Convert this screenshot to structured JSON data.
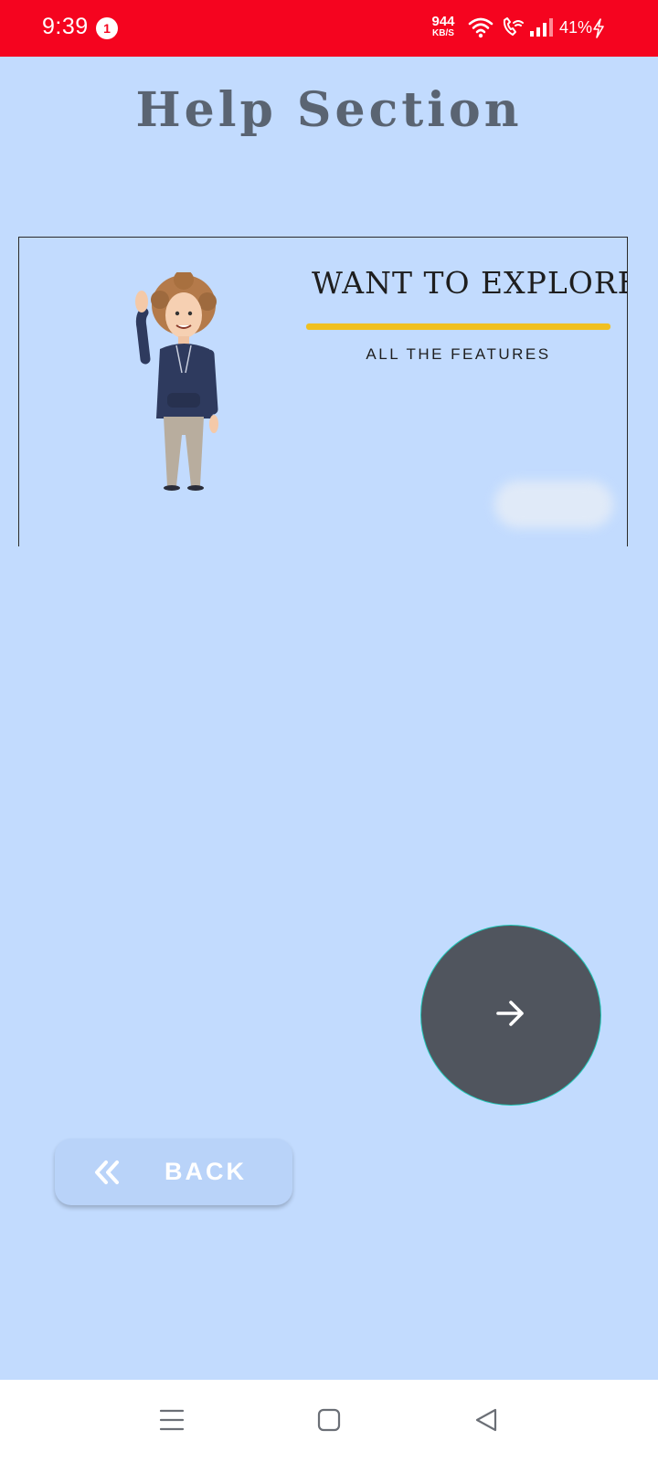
{
  "status_bar": {
    "time": "9:39",
    "notification_count": "1",
    "net_speed_value": "944",
    "net_speed_unit": "KB/S",
    "battery_percent": "41%",
    "background_color": "#f5041f"
  },
  "page": {
    "title": "Help Section",
    "background_color": "#c2dbfe"
  },
  "banner": {
    "headline": "WANT TO EXPLORE",
    "subline": "ALL THE FEATURES",
    "accent_color": "#f0c020"
  },
  "actions": {
    "next_icon": "arrow-right-icon",
    "next_color": "#50555e",
    "back_icon": "double-chevron-left-icon",
    "back_label": "BACK"
  },
  "nav_bar": {
    "buttons": [
      "menu-icon",
      "home-square-icon",
      "back-triangle-icon"
    ]
  }
}
